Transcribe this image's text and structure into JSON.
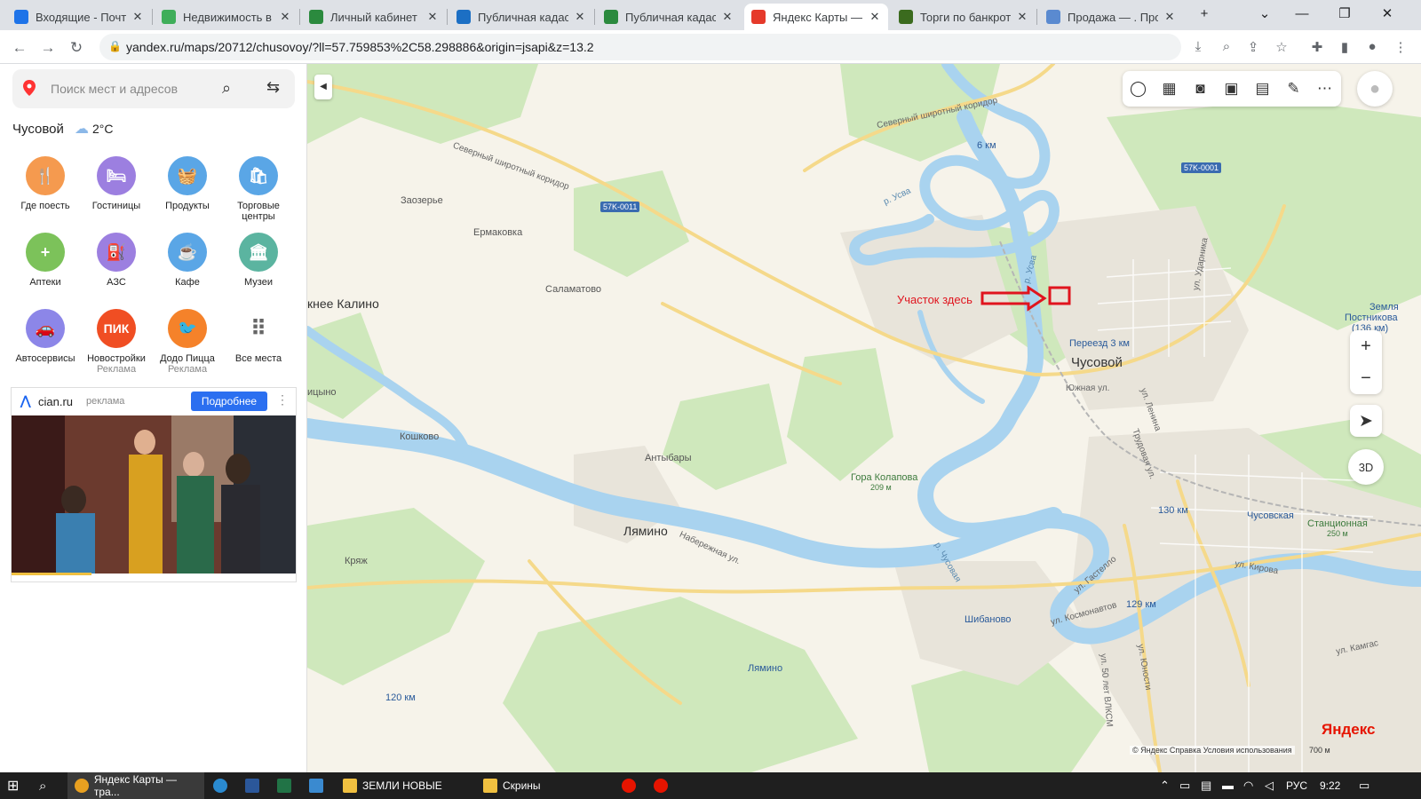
{
  "browser": {
    "tabs": [
      {
        "title": "Входящие - Почта",
        "favicon": "mail-icon",
        "color": "#1e73e8",
        "active": false
      },
      {
        "title": "Недвижимость в Е",
        "favicon": "realty-icon",
        "color": "#3fae5a",
        "active": false
      },
      {
        "title": "Личный кабинет",
        "favicon": "cabinet-icon",
        "color": "#2b8a3e",
        "active": false
      },
      {
        "title": "Публичная кадаст",
        "favicon": "cadastre-icon",
        "color": "#1c6fc4",
        "active": false
      },
      {
        "title": "Публичная кадаст",
        "favicon": "cadastre-icon",
        "color": "#2b8a3e",
        "active": false
      },
      {
        "title": "Яндекс Карты — т",
        "favicon": "yandex-maps-icon",
        "color": "#e53a2b",
        "active": true
      },
      {
        "title": "Торги по банкрот",
        "favicon": "auction-icon",
        "color": "#3b6b1e",
        "active": false
      },
      {
        "title": "Продажа — . Про",
        "favicon": "sale-icon",
        "color": "#5a8ad0",
        "active": false
      }
    ],
    "new_tab": "+",
    "url": "yandex.ru/maps/20712/chusovoy/?ll=57.759853%2C58.298886&origin=jsapi&z=13.2"
  },
  "sidebar": {
    "search_placeholder": "Поиск мест и адресов",
    "city": "Чусовой",
    "temperature": "2°C",
    "categories": [
      {
        "label": "Где поесть",
        "sub": "",
        "icon": "fork-knife-icon",
        "color": "#f59a4f",
        "glyph": "🍴"
      },
      {
        "label": "Гостиницы",
        "sub": "",
        "icon": "bed-icon",
        "color": "#9c7fe0",
        "glyph": "🛏"
      },
      {
        "label": "Продукты",
        "sub": "",
        "icon": "basket-icon",
        "color": "#5aa6e6",
        "glyph": "🧺"
      },
      {
        "label": "Торговые центры",
        "sub": "",
        "icon": "shopping-bag-icon",
        "color": "#5aa6e6",
        "glyph": "🛍"
      },
      {
        "label": "Аптеки",
        "sub": "",
        "icon": "pharmacy-icon",
        "color": "#7cc25a",
        "glyph": "+"
      },
      {
        "label": "АЗС",
        "sub": "",
        "icon": "fuel-icon",
        "color": "#9c7fe0",
        "glyph": "⛽"
      },
      {
        "label": "Кафе",
        "sub": "",
        "icon": "cup-icon",
        "color": "#5aa6e6",
        "glyph": "☕"
      },
      {
        "label": "Музеи",
        "sub": "",
        "icon": "museum-icon",
        "color": "#5bb4a0",
        "glyph": "🏛"
      },
      {
        "label": "Автосервисы",
        "sub": "",
        "icon": "car-service-icon",
        "color": "#8c86e8",
        "glyph": "🚗"
      },
      {
        "label": "Новостройки",
        "sub": "Реклама",
        "icon": "pik-logo-icon",
        "color": "#f04e23",
        "glyph": "ПИК"
      },
      {
        "label": "Додо Пицца",
        "sub": "Реклама",
        "icon": "dodo-logo-icon",
        "color": "#f5822a",
        "glyph": "🐦"
      },
      {
        "label": "Все места",
        "sub": "",
        "icon": "grid-dots-icon",
        "color": "#ffffff",
        "glyph": "⠿"
      }
    ],
    "ad": {
      "domain": "cian.ru",
      "tag": "реклама",
      "button": "Подробнее"
    }
  },
  "map": {
    "labels": {
      "corridor1": "Северный широтный коридор",
      "corridor2": "Северный широтный коридор",
      "zaozerie": "Заозерье",
      "ermakovka": "Ермаковка",
      "salamatovo": "Саламатово",
      "kalino": "кнее Калино",
      "kishkovo": "Кошково",
      "antybary": "Антыбары",
      "lyamino": "Лямино",
      "kryazh": "Кряж",
      "tsyno": "ицыно",
      "chusovoy": "Чусовой",
      "gora": "Гора Колапова",
      "gora_h": "209 м",
      "pereezd": "Переезд 3 км",
      "yuzhnaya": "Южная ул.",
      "shibanovo": "Шибаново",
      "lyamino_st": "Лямино",
      "chusovskaya": "Чусовская",
      "stantsionnaya": "Станционная",
      "st_h": "250 м",
      "zemlya": "Земля",
      "postnikova": "Постникова",
      "p136": "(136 км)",
      "r_usva": "р. Усва",
      "r_usva2": "р. Усва",
      "r_chusovaya": "р. Чусовая",
      "ul_udarnika": "ул. Ударника",
      "ul_lenina": "ул. Ленина",
      "trudovaya": "Трудовая ул.",
      "naberezhnaya": "Набережная ул.",
      "gastello": "ул. Гастелло",
      "kosmonavtov": "ул. Космонавтов",
      "kirova": "ул. Кирова",
      "yunosti": "ул. Юности",
      "vlksm": "ул. 50 лет ВЛКСМ",
      "kamgas": "ул. Камгас",
      "km6": "6 км",
      "km120": "120 км",
      "km129": "129 км",
      "km130": "130 км",
      "shield1": "57K-0011",
      "shield2": "57K-0001"
    },
    "annotation": "Участок здесь",
    "controls": {
      "d3": "3D"
    },
    "copyright": "© Яндекс  Справка  Условия использования",
    "scale": "700 м",
    "logo": "Яндекс"
  },
  "taskbar": {
    "items": [
      {
        "label": "Яндекс Карты — тра...",
        "icon": "chrome-icon"
      },
      {
        "label": "ЗЕМЛИ НОВЫЕ",
        "icon": "folder-icon"
      },
      {
        "label": "Скрины",
        "icon": "folder-icon"
      }
    ],
    "lang": "РУС",
    "time": "9:22"
  }
}
